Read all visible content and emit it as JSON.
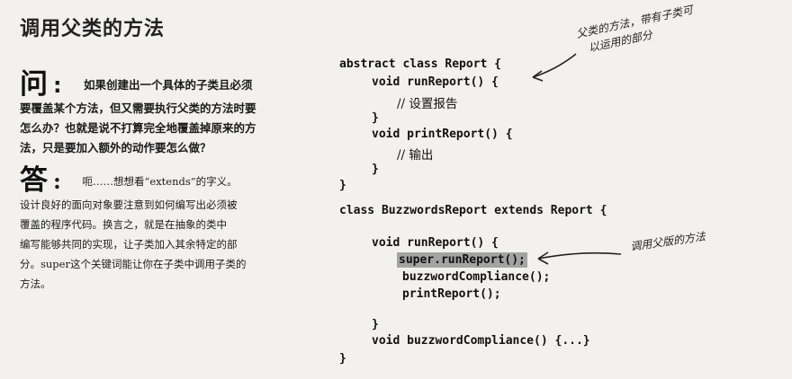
{
  "title": "调用父类的方法",
  "question": {
    "mark": "问",
    "line1": "如果创建出一个具体的子类且必须",
    "line2": "要覆盖某个方法，但又需要执行父类的方法时要",
    "line3": "怎么办？也就是说不打算完全地覆盖掉原来的方",
    "line4": "法，只是要加入额外的动作要怎么做？"
  },
  "answer": {
    "mark": "答",
    "line1": "呃……想想看“extends”的字义。",
    "line2": "设计良好的面向对象要注意到如何编写出必须被",
    "line3": "覆盖的程序代码。换言之，就是在抽象的类中",
    "line4": "编写能够共同的实现，让子类加入其余特定的部",
    "line5": "分。super这个关键词能让你在子类中调用子类的",
    "line6": "方法。"
  },
  "code": {
    "l1": "abstract class Report {",
    "l2": "void runReport() {",
    "l3": "// 设置报告",
    "l4": "}",
    "l5": "void printReport() {",
    "l6": "// 输出",
    "l7": "}",
    "l8": "}",
    "l9": "class BuzzwordsReport extends Report {",
    "l10": "void runReport() {",
    "l11": "super.runReport();",
    "l12": "buzzwordCompliance();",
    "l13": "printReport();",
    "l14": "}",
    "l15": "void buzzwordCompliance() {...}",
    "l16": "}"
  },
  "notes": {
    "top_line1": "父类的方法，带有子类可",
    "top_line2": "以运用的部分",
    "right": "调用父版的方法"
  }
}
